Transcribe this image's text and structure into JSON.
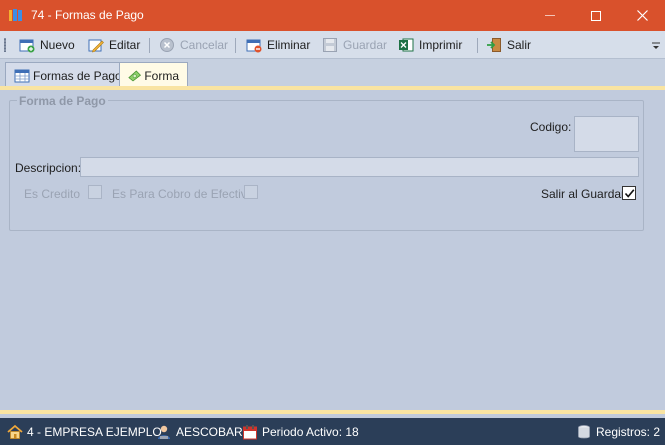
{
  "window": {
    "title": "74 - Formas de Pago"
  },
  "toolbar": {
    "nuevo": "Nuevo",
    "editar": "Editar",
    "cancelar": "Cancelar",
    "eliminar": "Eliminar",
    "guardar": "Guardar",
    "imprimir": "Imprimir",
    "salir": "Salir"
  },
  "tabs": [
    {
      "label": "Formas de Pago",
      "active": false
    },
    {
      "label": "Forma",
      "active": true
    }
  ],
  "form": {
    "group_title": "Forma de Pago",
    "codigo_label": "Codigo:",
    "codigo_value": "",
    "descripcion_label": "Descripcion:",
    "descripcion_value": "",
    "es_credito_label": "Es Credito",
    "es_credito_checked": false,
    "es_para_cobro_label": "Es Para Cobro de Efectivo",
    "es_para_cobro_checked": false,
    "salir_al_guardar_label": "Salir al Guardar",
    "salir_al_guardar_checked": true
  },
  "status": {
    "empresa": "4 - EMPRESA EJEMPLO",
    "usuario": "AESCOBAR",
    "periodo": "Periodo Activo: 18",
    "registros": "Registros: 2"
  },
  "colors": {
    "titlebar": "#d9512c",
    "statusbar": "#2b3e58",
    "accent_line": "#f9e4a2"
  }
}
